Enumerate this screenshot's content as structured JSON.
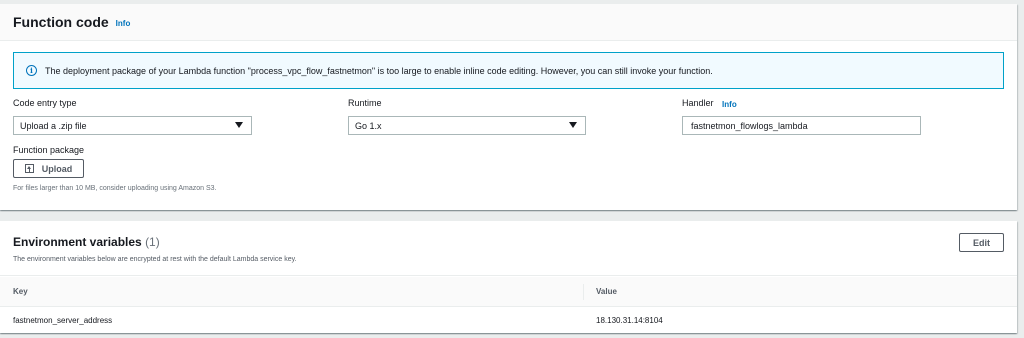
{
  "function_code": {
    "title": "Function code",
    "info_label": "Info",
    "notice": {
      "icon": "info-circle-icon",
      "text": "The deployment package of your Lambda function \"process_vpc_flow_fastnetmon\" is too large to enable inline code editing. However, you can still invoke your function."
    },
    "code_entry_type": {
      "label": "Code entry type",
      "value": "Upload a .zip file"
    },
    "runtime": {
      "label": "Runtime",
      "value": "Go 1.x"
    },
    "handler": {
      "label": "Handler",
      "info_label": "Info",
      "value": "fastnetmon_flowlogs_lambda"
    },
    "function_package": {
      "label": "Function package",
      "upload_label": "Upload",
      "upload_icon": "upload-icon",
      "hint": "For files larger than 10 MB, consider uploading using Amazon S3."
    }
  },
  "environment_variables": {
    "title": "Environment variables",
    "count": "(1)",
    "description": "The environment variables below are encrypted at rest with the default Lambda service key.",
    "edit_label": "Edit",
    "columns": [
      "Key",
      "Value"
    ],
    "rows": [
      {
        "key": "fastnetmon_server_address",
        "value": "18.130.31.14:8104"
      }
    ]
  },
  "colors": {
    "page_bg": "#eaeded",
    "link": "#0073bb",
    "notice_border": "#00a1c9",
    "notice_bg": "#f1faff"
  }
}
